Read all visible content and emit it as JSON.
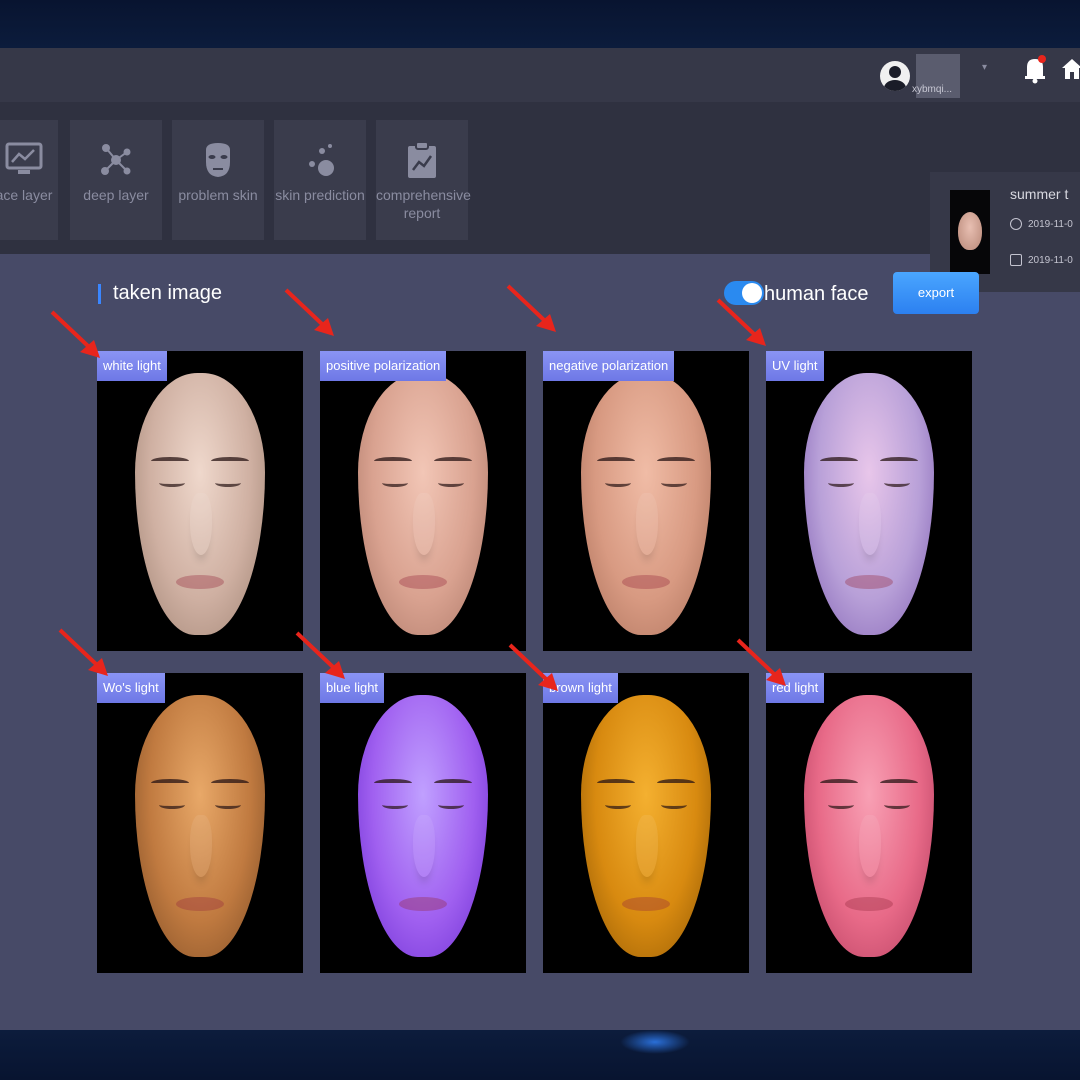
{
  "topbar": {
    "username": "xybmqi..."
  },
  "toolbar": {
    "tools": [
      {
        "label": "ace layer",
        "icon": "monitor-chart-icon"
      },
      {
        "label": "deep layer",
        "icon": "molecule-icon"
      },
      {
        "label": "problem skin",
        "icon": "face-mask-icon"
      },
      {
        "label": "skin prediction",
        "icon": "bubbles-icon"
      },
      {
        "label": "comprehensive report",
        "icon": "clipboard-chart-icon"
      }
    ]
  },
  "patient": {
    "name": "summer  t",
    "date1": "2019-11-0",
    "date2": "2019-11-0"
  },
  "content": {
    "title": "taken image",
    "toggle_label": "human face",
    "toggle_on": true,
    "export_label": "export"
  },
  "images": [
    {
      "label": "white light",
      "skin": [
        "#efd8cc",
        "#cfb0a2",
        "#9c8070"
      ]
    },
    {
      "label": "positive polarization",
      "skin": [
        "#f2c6b6",
        "#d9a290",
        "#a87464"
      ]
    },
    {
      "label": "negative polarization",
      "skin": [
        "#f0bca6",
        "#d89a82",
        "#a86e58"
      ]
    },
    {
      "label": "UV light",
      "skin": [
        "#e8c6ea",
        "#b8a0d8",
        "#7c5cb0"
      ]
    },
    {
      "label": "Wo's light",
      "skin": [
        "#e8a868",
        "#c07a40",
        "#7a4a24"
      ]
    },
    {
      "label": "blue light",
      "skin": [
        "#c0a0ff",
        "#a060f0",
        "#6a2cd0"
      ]
    },
    {
      "label": "brown light",
      "skin": [
        "#f4b030",
        "#d88a10",
        "#8a5404"
      ]
    },
    {
      "label": "red light",
      "skin": [
        "#f8a0b4",
        "#e86a88",
        "#b03a5c"
      ]
    }
  ],
  "colors": {
    "accent": "#2a8af0",
    "tag": "#7b85f0",
    "arrow": "#e8251c"
  }
}
